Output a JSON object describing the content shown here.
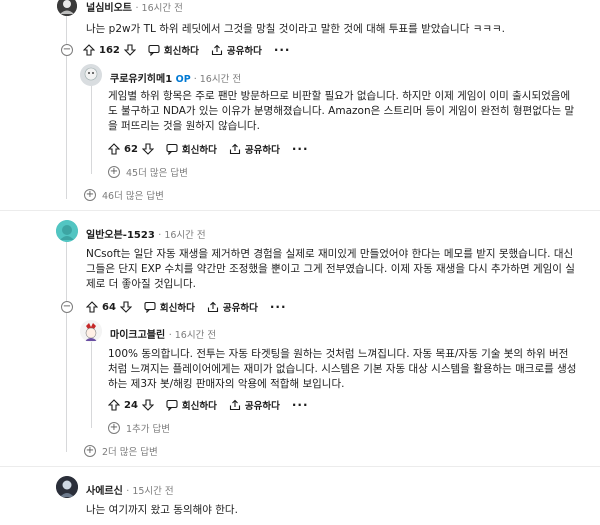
{
  "comments": [
    {
      "user": "널심비오트",
      "time": "16시간 전",
      "text": "나는 p2w가 TL 하위 레딧에서 그것을 망칠 것이라고 말한 것에 대해 투표를 받았습니다 ㅋㅋㅋ.",
      "votes": "162",
      "reply": "회신하다",
      "share": "공유하다",
      "more": "···"
    },
    {
      "user": "쿠로유키히메1",
      "op": "OP",
      "time": "16시간 전",
      "text": "게임별 하위 항목은 주로 팬만 방문하므로 비판할 필요가 없습니다. 하지만 이제 게임이 이미 출시되었음에도 불구하고 NDA가 있는 이유가 분명해졌습니다. Amazon은 스트리머 등이 게임이 완전히 형편없다는 말을 퍼뜨리는 것을 원하지 않습니다.",
      "votes": "62",
      "reply": "회신하다",
      "share": "공유하다",
      "more": "···",
      "more_replies": "45더 많은 답변"
    },
    {
      "more_replies": "46더 많은 답변"
    },
    {
      "user": "일반오븐-1523",
      "time": "16시간 전",
      "text": "NCsoft는 일단 자동 재생을 제거하면 경험을 실제로 재미있게 만들었어야 한다는 메모를 받지 못했습니다. 대신 그들은 단지 EXP 수치를 약간만 조정했을 뿐이고 그게 전부였습니다. 이제 자동 재생을 다시 추가하면 게임이 실제로 더 좋아질 것입니다.",
      "votes": "64",
      "reply": "회신하다",
      "share": "공유하다",
      "more": "···"
    },
    {
      "user": "마이크고블린",
      "time": "16시간 전",
      "text": "100% 동의합니다. 전투는 자동 타겟팅을 원하는 것처럼 느껴집니다. 자동 목표/자동 기술 봇의 하위 버전처럼 느껴지는 플레이어에게는 재미가 없습니다. 시스템은 기본 자동 대상 시스템을 활용하는 매크로를 생성하는 제3자 봇/해킹 판매자의 악용에 적합해 보입니다.",
      "votes": "24",
      "reply": "회신하다",
      "share": "공유하다",
      "more": "···",
      "more_replies": "1추가 답변"
    },
    {
      "more_replies": "2더 많은 답변"
    },
    {
      "user": "사에르신",
      "time": "15시간 전",
      "text": "나는 여기까지 왔고 동의해야 한다."
    }
  ],
  "icons": {
    "upvote": "arrow-up-icon",
    "downvote": "arrow-down-icon",
    "reply": "chat-bubble-icon",
    "share": "share-icon",
    "collapse": "minus-circle-icon",
    "expand": "plus-circle-icon"
  },
  "colors": {
    "op_badge": "#0079d3",
    "muted": "#7c7c7c",
    "thread_line": "#d7d8da"
  }
}
